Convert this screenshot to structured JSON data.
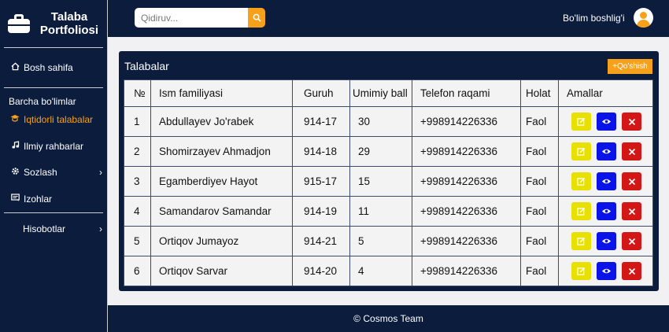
{
  "brand": {
    "title_line1": "Talaba",
    "title_line2": "Portfoliosi"
  },
  "sidebar": {
    "section_label": "Barcha bo'limlar",
    "items": [
      {
        "label": "Bosh sahifa",
        "icon": "home-icon"
      },
      {
        "label": "Iqtidorli talabalar",
        "icon": "graduation-cap-icon",
        "active": true
      },
      {
        "label": "Ilmiy rahbarlar",
        "icon": "music-note-icon"
      },
      {
        "label": "Sozlash",
        "icon": "gear-icon"
      },
      {
        "label": "Izohlar",
        "icon": "comment-icon"
      },
      {
        "label": "Hisobotlar",
        "icon": "chevron-right-icon"
      }
    ]
  },
  "header": {
    "search_placeholder": "Qidiruv...",
    "user_label": "Bo'lim boshlig'i"
  },
  "main": {
    "title": "Talabalar",
    "add_button": "+Qo'shish",
    "table": {
      "columns": [
        "№",
        "Ism familiyasi",
        "Guruh",
        "Umimiy ball",
        "Telefon raqami",
        "Holat",
        "Amallar"
      ],
      "rows": [
        {
          "n": "1",
          "name": "Abdullayev Jo'rabek",
          "group": "914-17",
          "ball": "30",
          "phone": "+998914226336",
          "status": "Faol"
        },
        {
          "n": "2",
          "name": "Shomirzayev Ahmadjon",
          "group": "914-18",
          "ball": "29",
          "phone": "+998914226336",
          "status": "Faol"
        },
        {
          "n": "3",
          "name": "Egamberdiyev Hayot",
          "group": "915-17",
          "ball": "15",
          "phone": "+998914226336",
          "status": "Faol"
        },
        {
          "n": "4",
          "name": "Samandarov Samandar",
          "group": "914-19",
          "ball": "11",
          "phone": "+998914226336",
          "status": "Faol"
        },
        {
          "n": "5",
          "name": "Ortiqov Jumayoz",
          "group": "914-21",
          "ball": "5",
          "phone": "+998914226336",
          "status": "Faol"
        },
        {
          "n": "6",
          "name": "Ortiqov Sarvar",
          "group": "914-20",
          "ball": "4",
          "phone": "+998914226336",
          "status": "Faol"
        }
      ]
    }
  },
  "footer": {
    "text": "© Cosmos Team"
  },
  "colors": {
    "navy": "#0c1c3d",
    "accent": "#f7a11a",
    "edit": "#e8e000",
    "view": "#0a14e8",
    "delete": "#d31717"
  }
}
